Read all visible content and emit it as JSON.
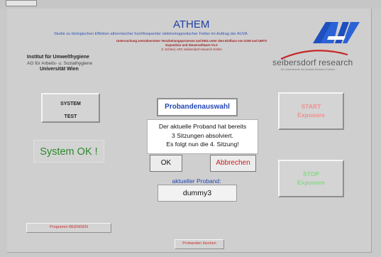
{
  "header": {
    "title": "ATHEM",
    "study_line": "Studie zu biologischen Effekten athermischer hochfrequenter elektromagnetischer Felder im Auftrag der AUVA",
    "sub_line1": "Untersuchung zentralnervöser Verarbeitungsprozesse und EEG unter dem Einfluss von GSM und UMTS",
    "sub_line2": "Exposition und Steuersoftware V1.0",
    "sub_line3": "Z. Schmid, ARC Seibersdorf research GmbH"
  },
  "institute": {
    "name": "Institut für Umwelthygiene",
    "department": "AG für Arbeits- u. Sozialhygiene",
    "university": "Universität Wien"
  },
  "sponsor": {
    "name": "seibersdorf research",
    "tagline": "Ein Unternehmen der Austrian Research Centers"
  },
  "buttons": {
    "system_test_line1": "SYSTEM",
    "system_test_line2": "TEST",
    "start_line1": "START",
    "start_line2": "Exposure",
    "stop_line1": "STOP",
    "stop_line2": "Exposure",
    "proband_select": "Probandenauswahl",
    "quit": "Programm BEENDEN",
    "delete_proband": "Probanden löschen"
  },
  "status": {
    "system": "System OK !"
  },
  "dialog": {
    "line1": "Der aktuelle Proband hat bereits",
    "line2": "3 Sitzungen absolviert.",
    "line3": "Es folgt nun die 4. Sitzung!",
    "ok": "OK",
    "cancel": "Abbrechen"
  },
  "proband": {
    "label": "aktueller Proband:",
    "value": "dummy3"
  },
  "colors": {
    "panel": "#cfcfcf",
    "title_blue": "#1e3fa5",
    "status_green": "#2c8a2c",
    "start_red": "#f08f8f",
    "stop_green": "#8cd58c"
  }
}
